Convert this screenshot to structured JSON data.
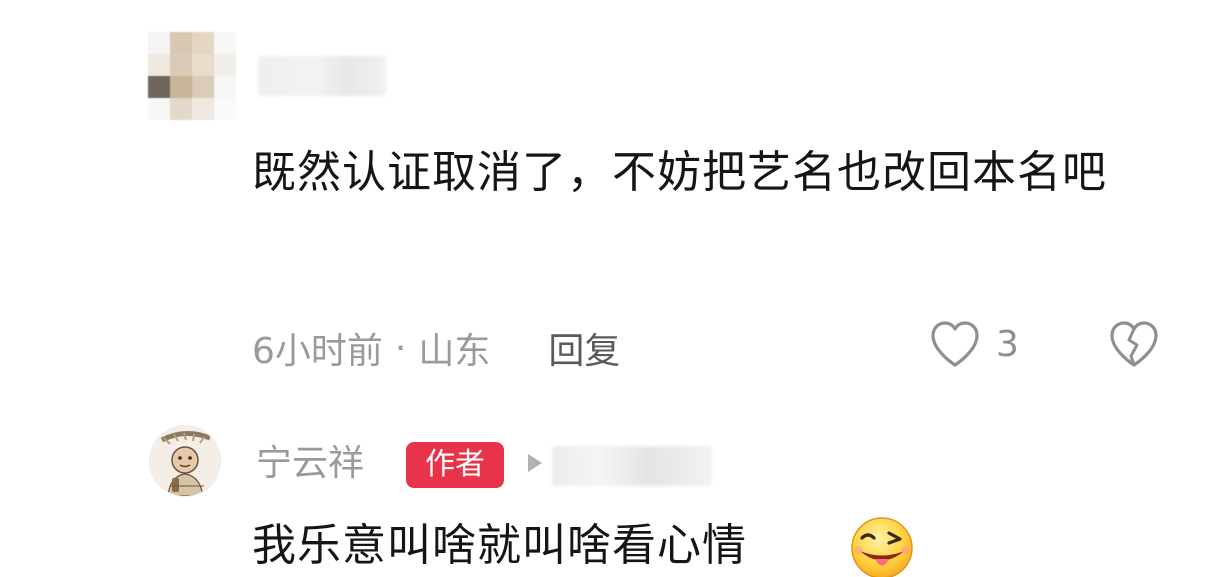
{
  "comment": {
    "text": "既然认证取消了，不妨把艺名也改回本名吧",
    "time": "6小时前",
    "separator": "·",
    "location": "山东",
    "reply_label": "回复",
    "like_count": "3"
  },
  "reply": {
    "author_name": "宁云祥",
    "author_badge": "作者",
    "text": "我乐意叫啥就叫啥看心情"
  },
  "colors": {
    "badge": "#e8344a",
    "meta_text": "#9a9a9a",
    "body_text": "#151515"
  },
  "icons": {
    "like": "heart-outline-icon",
    "dislike": "broken-heart-icon",
    "arrow": "play-triangle-icon",
    "emoji": "wink-tongue-emoji-icon"
  }
}
